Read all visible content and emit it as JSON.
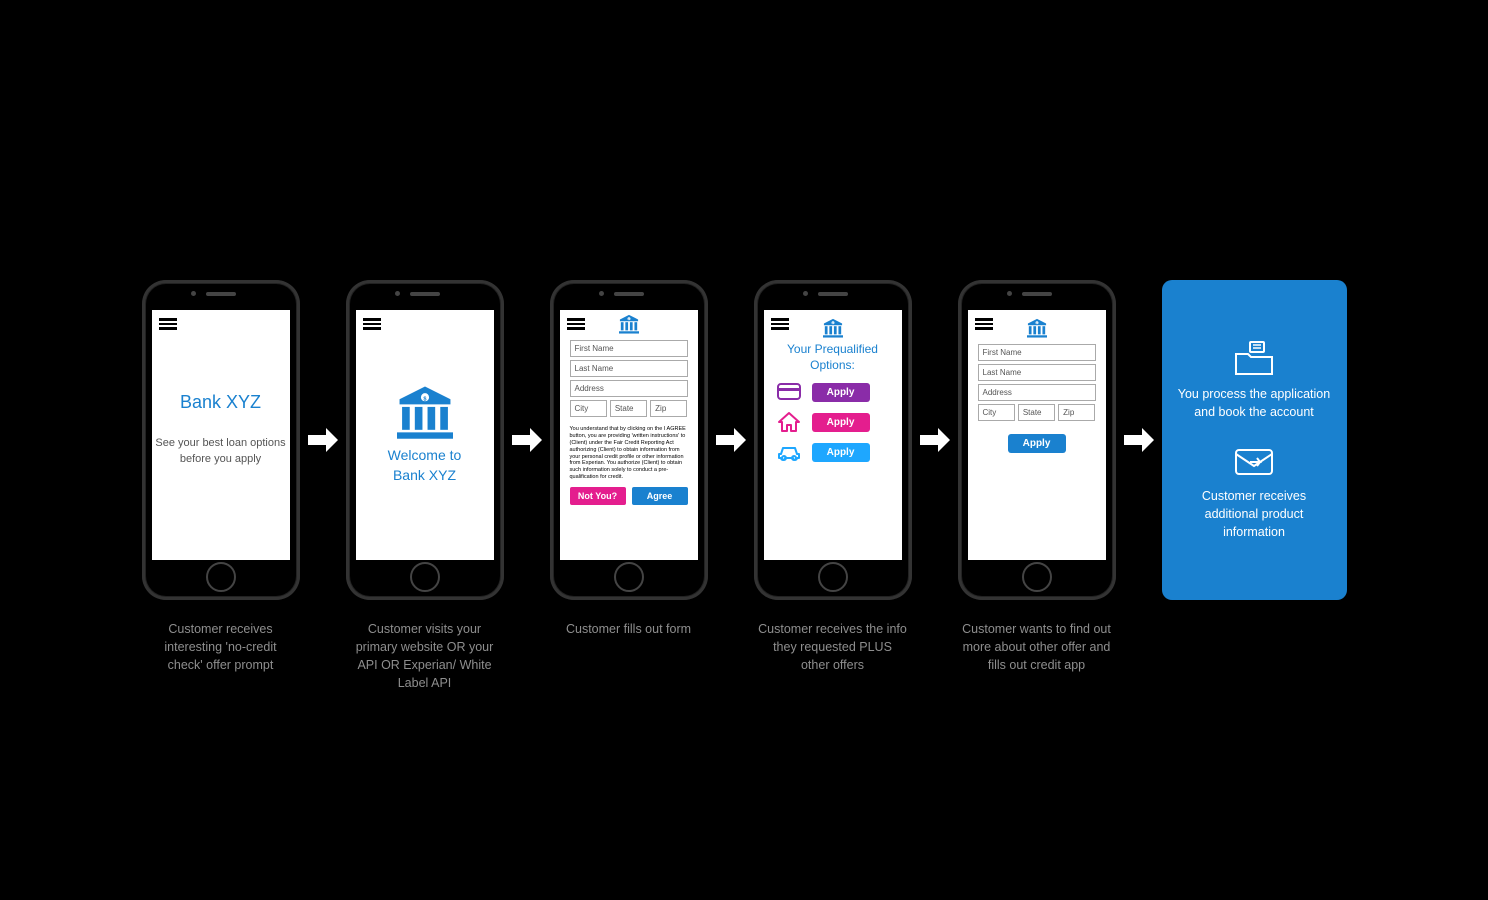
{
  "screens": {
    "s1": {
      "title": "Bank XYZ",
      "subtitle": "See your best loan options before you apply"
    },
    "s2": {
      "line1": "Welcome to",
      "line2": "Bank XYZ"
    },
    "s3": {
      "fields": {
        "first": "First Name",
        "last": "Last Name",
        "addr": "Address",
        "city": "City",
        "state": "State",
        "zip": "Zip"
      },
      "finePrint": "You understand that by clicking on the I AGREE button, you are providing 'written instructions' to (Client) under the Fair Credit Reporting Act authorizing (Client) to obtain information from your personal credit profile or other information from Experian. You authorize (Client) to obtain such information solely to conduct a pre-qualification for credit.",
      "notYou": "Not You?",
      "agree": "Agree"
    },
    "s4": {
      "title": "Your Prequalified Options:",
      "apply": "Apply"
    },
    "s5": {
      "fields": {
        "first": "First Name",
        "last": "Last Name",
        "addr": "Address",
        "city": "City",
        "state": "State",
        "zip": "Zip"
      },
      "apply": "Apply"
    }
  },
  "final": {
    "top": "You process the application and book the account",
    "bottom": "Customer receives additional product information"
  },
  "captions": {
    "c1": "Customer receives interesting 'no-credit check' offer prompt",
    "c2": "Customer visits your primary website OR your API OR Experian/ White Label API",
    "c3": "Customer fills out form",
    "c4": "Customer receives the info they requested PLUS other offers",
    "c5": "Customer wants to find out more about other offer and fills out credit app"
  }
}
